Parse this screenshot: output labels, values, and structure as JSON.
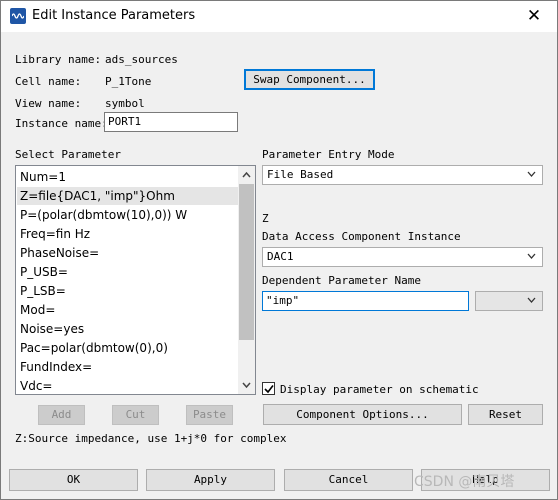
{
  "window": {
    "title": "Edit Instance Parameters",
    "close_glyph": "✕"
  },
  "info": {
    "library_label": "Library name:",
    "library_value": "ads_sources",
    "cell_label": "Cell name:",
    "cell_value": "P_1Tone",
    "view_label": "View name:",
    "view_value": "symbol",
    "instance_label": "Instance name:",
    "instance_value": "PORT1",
    "swap_button": "Swap Component..."
  },
  "select_parameter": {
    "heading": "Select Parameter",
    "items": [
      "Num=1",
      "Z=file{DAC1, \"imp\"}Ohm",
      "P=(polar(dbmtow(10),0)) W",
      "Freq=fin Hz",
      "PhaseNoise=",
      "P_USB=",
      "P_LSB=",
      "Mod=",
      "Noise=yes",
      "Pac=polar(dbmtow(0),0)",
      "FundIndex=",
      "Vdc="
    ],
    "selected_index": 1,
    "add_button": "Add",
    "cut_button": "Cut",
    "paste_button": "Paste"
  },
  "entry": {
    "mode_label": "Parameter Entry Mode",
    "mode_value": "File Based",
    "param_name": "Z",
    "dac_label": "Data Access Component Instance",
    "dac_value": "DAC1",
    "dependent_label": "Dependent Parameter Name",
    "dependent_value": "\"imp\"",
    "display_checkbox_label": "Display parameter on schematic",
    "display_checked": true,
    "component_options_button": "Component Options...",
    "reset_button": "Reset"
  },
  "description": "Z:Source impedance, use 1+j*0 for complex",
  "footer": {
    "ok": "OK",
    "apply": "Apply",
    "cancel": "Cancel",
    "help": "Help"
  },
  "watermark": "CSDN @南贝塔"
}
